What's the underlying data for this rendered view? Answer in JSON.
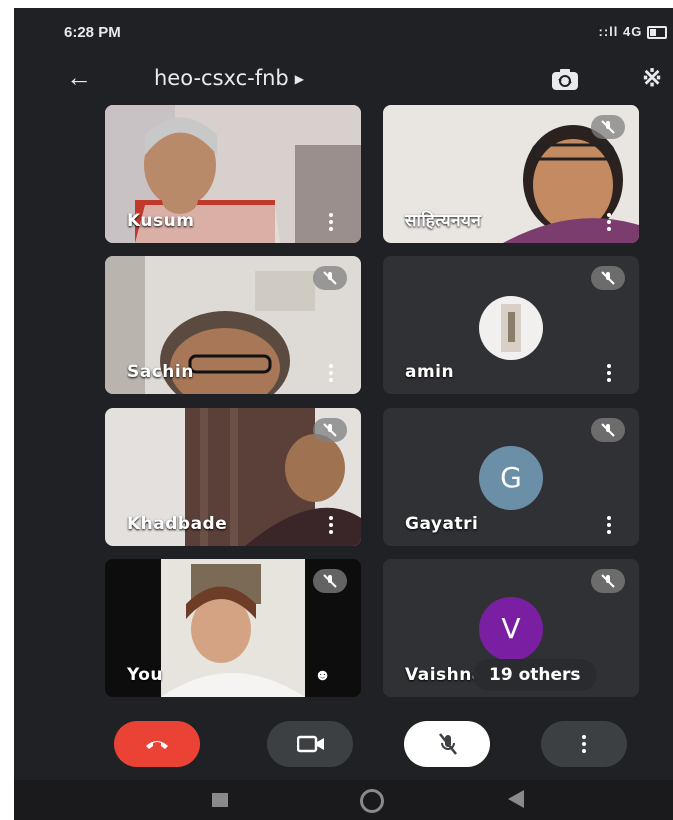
{
  "status": {
    "time": "6:28 PM",
    "network": "4G"
  },
  "meeting": {
    "code": "heo-csxc-fnb"
  },
  "tiles": [
    {
      "name": "Kusum"
    },
    {
      "name": "साहित्यनयन"
    },
    {
      "name": "Sachin"
    },
    {
      "name": "amin"
    },
    {
      "name": "Khadbade"
    },
    {
      "name": "Gayatri",
      "initial": "G"
    },
    {
      "name": "You"
    },
    {
      "name": "Vaishnavi",
      "initial": "V"
    }
  ],
  "others_badge": "19 others",
  "colors": {
    "end_call": "#ea4335",
    "avatar_g": "#6b8fa6",
    "avatar_v": "#7b1fa2"
  },
  "icons": [
    "back-arrow-icon",
    "flip-camera-icon",
    "bluetooth-icon",
    "end-call-icon",
    "video-icon",
    "mic-off-icon",
    "more-icon"
  ]
}
